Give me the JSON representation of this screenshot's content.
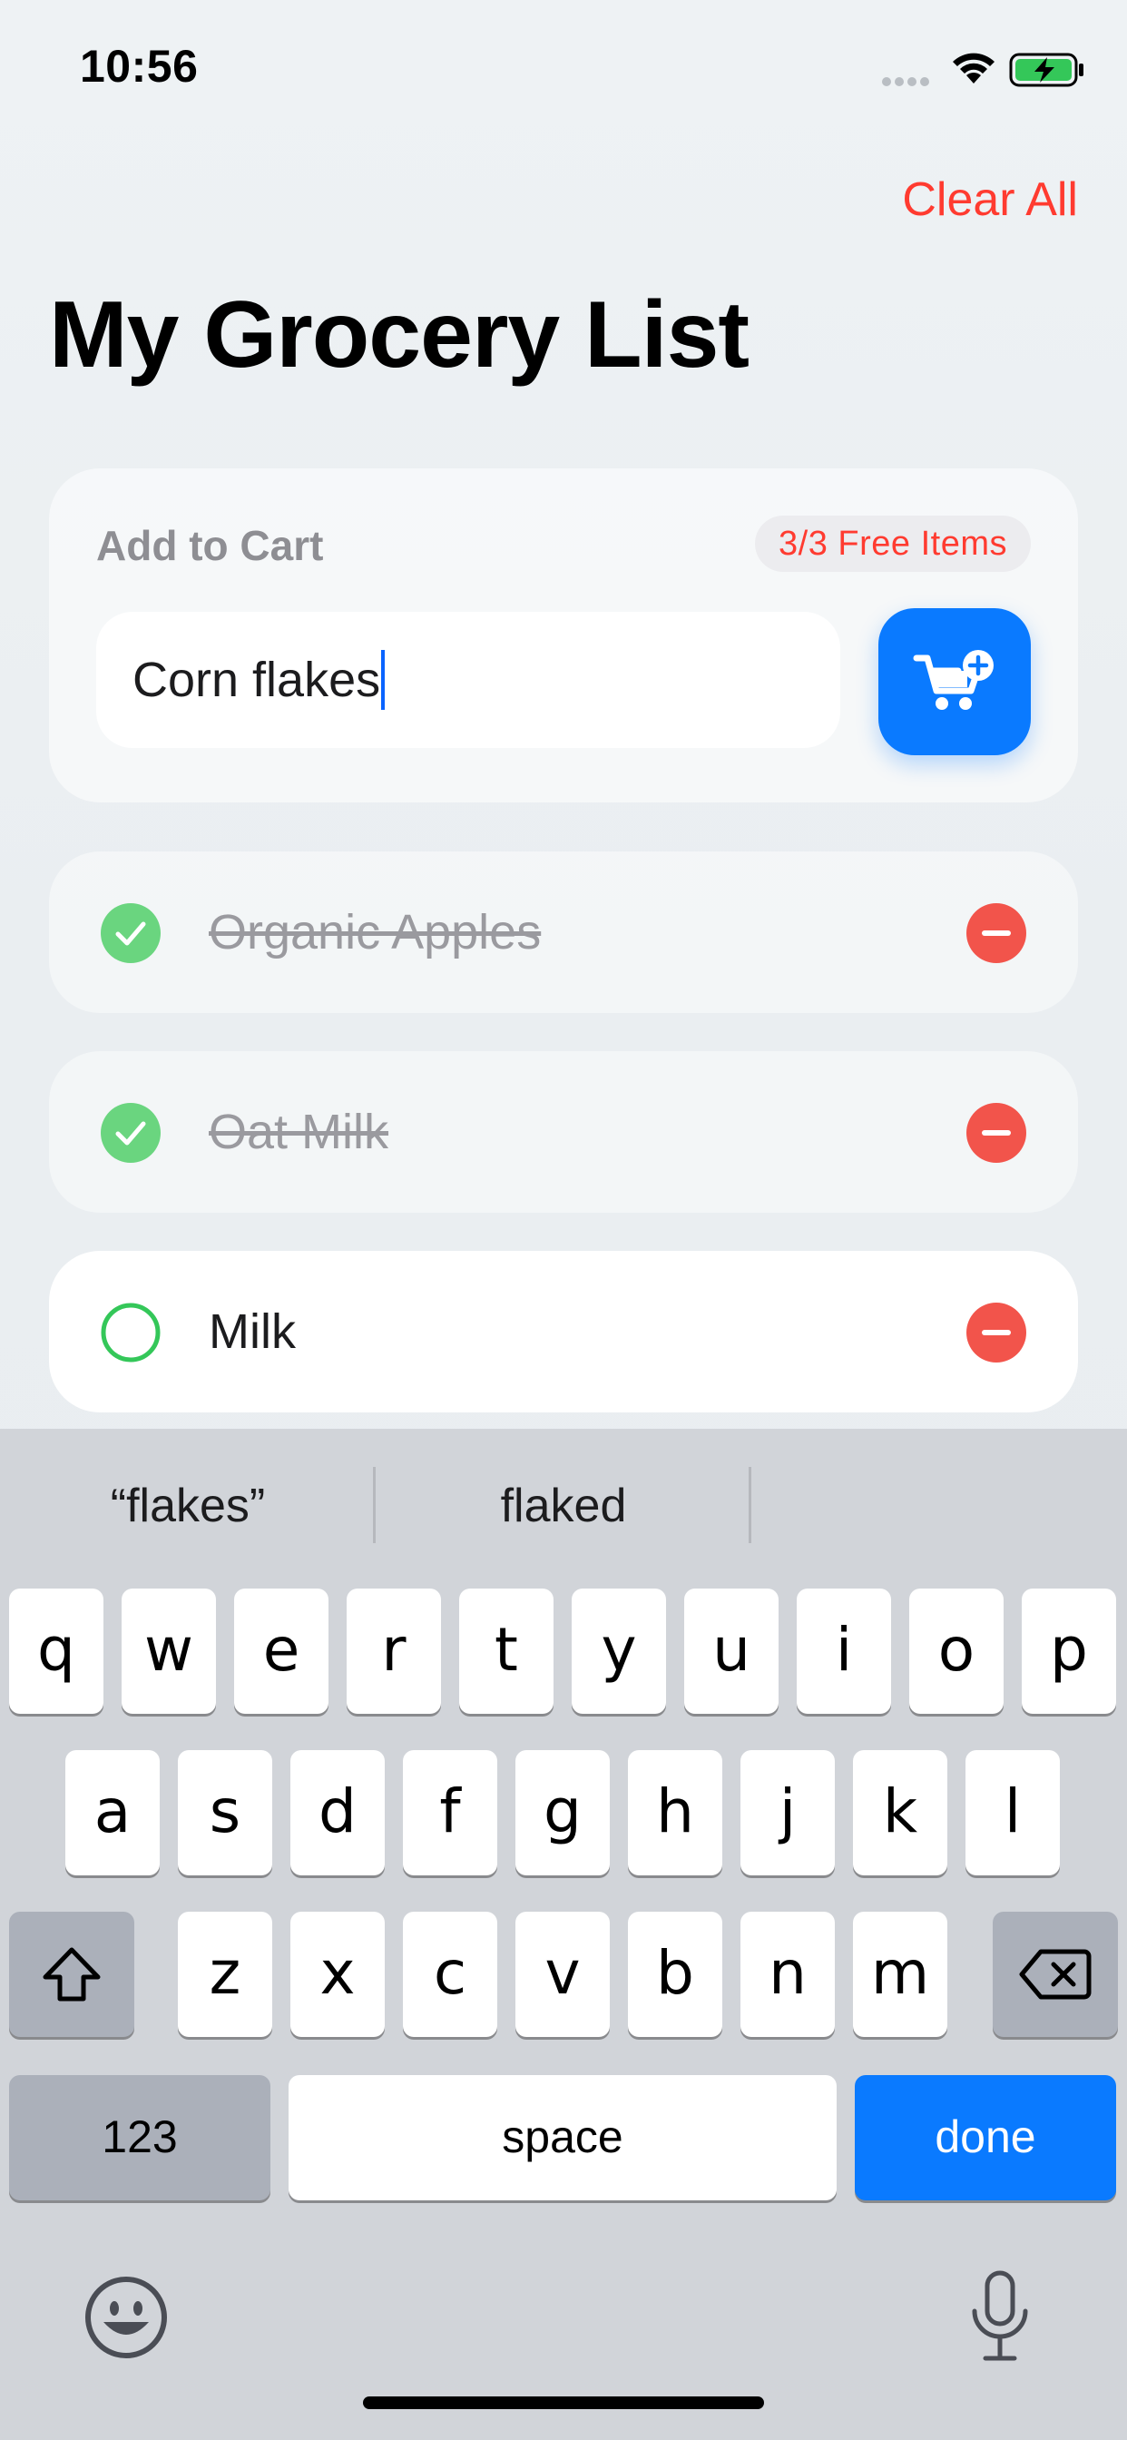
{
  "status_bar": {
    "time": "10:56",
    "battery_color": "#34c759"
  },
  "header": {
    "clear_all_label": "Clear All",
    "title": "My Grocery List"
  },
  "add_card": {
    "label": "Add to Cart",
    "free_badge": "3/3 Free Items",
    "input_value": "Corn flakes",
    "add_button_icon": "cart-plus-icon"
  },
  "items": [
    {
      "label": "Organic Apples",
      "checked": true
    },
    {
      "label": "Oat Milk",
      "checked": true
    },
    {
      "label": "Milk",
      "checked": false
    }
  ],
  "keyboard": {
    "suggestions": [
      "“flakes”",
      "flaked",
      ""
    ],
    "row1": [
      "q",
      "w",
      "e",
      "r",
      "t",
      "y",
      "u",
      "i",
      "o",
      "p"
    ],
    "row2": [
      "a",
      "s",
      "d",
      "f",
      "g",
      "h",
      "j",
      "k",
      "l"
    ],
    "row3": [
      "z",
      "x",
      "c",
      "v",
      "b",
      "n",
      "m"
    ],
    "numbers_label": "123",
    "space_label": "space",
    "done_label": "done"
  },
  "colors": {
    "accent_blue": "#0a7aff",
    "destructive_red": "#ff3b30",
    "check_green": "#34c759",
    "remove_red": "#f2544b"
  }
}
